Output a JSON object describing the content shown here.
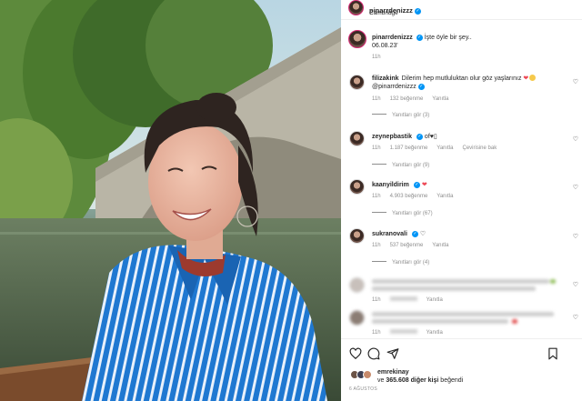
{
  "post": {
    "username": "pinarrdenizzz",
    "location": "Cambridge",
    "verified_mark": "✓"
  },
  "caption": {
    "username": "pinarrdenizzz",
    "text": "İşte öyle bir şey..",
    "date_line": "06.08.23'",
    "time": "11h"
  },
  "comments": [
    {
      "username": "filizakink",
      "text": "Dilerim hep mutluluktan olur göz yaşlarınız",
      "mention": "@pinarrdenizzz",
      "time": "11h",
      "likes": "132 beğenme",
      "reply": "Yanıtla",
      "view_replies": "Yanıtları gör (3)"
    },
    {
      "username": "zeynepbastik",
      "text": "of",
      "time": "11h",
      "likes": "1.187 beğenme",
      "reply": "Yanıtla",
      "translate": "Çevirisine bak",
      "view_replies": "Yanıtları gör (9)"
    },
    {
      "username": "kaanyildirim",
      "time": "11h",
      "likes": "4.903 beğenme",
      "reply": "Yanıtla",
      "view_replies": "Yanıtları gör (67)"
    },
    {
      "username": "sukranovali",
      "time": "11h",
      "likes": "537 beğenme",
      "reply": "Yanıtla",
      "view_replies": "Yanıtları gör (4)"
    },
    {
      "blurred": true,
      "time": "11h",
      "likes": "",
      "reply": "Yanıtla"
    },
    {
      "blurred": true,
      "time": "11h",
      "likes": "",
      "reply": "Yanıtla"
    }
  ],
  "actions": {
    "like_icon": "heart-outline-icon",
    "comment_icon": "comment-icon",
    "share_icon": "share-icon",
    "save_icon": "bookmark-icon"
  },
  "likes": {
    "first_liker": "emrekinay",
    "connector": "ve",
    "others": "365.608 diğer kişi",
    "suffix": "beğendi"
  },
  "date": "6 Ağustos",
  "colors": {
    "verified": "#0095f6",
    "secondary_text": "#8e8e8e",
    "shirt_blue": "#1f78d1",
    "heart_red": "#ed4956"
  }
}
